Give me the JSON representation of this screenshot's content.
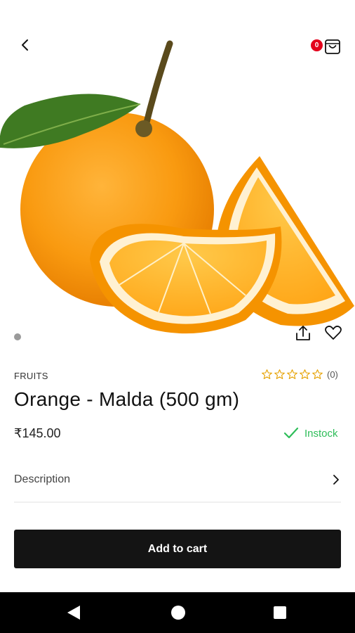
{
  "header": {
    "back_icon": "chevron-left-icon",
    "cart_icon": "shopping-bag-icon",
    "cart_count": "0",
    "badge_color": "#e3001b"
  },
  "hero": {
    "image_subject": "orange with leaf and slices",
    "carousel_index": 1,
    "share_icon": "share-icon",
    "favorite_icon": "heart-icon"
  },
  "product": {
    "category": "FRUITS",
    "name": "Orange - Malda (500 gm)",
    "price": "₹145.00",
    "rating_stars": 0,
    "rating_max": 5,
    "rating_count": "(0)",
    "stock_label": "Instock",
    "stock_color": "#2ebd59",
    "star_color": "#e6a100"
  },
  "details": {
    "description_label": "Description"
  },
  "actions": {
    "add_to_cart_label": "Add to cart",
    "button_color": "#141414"
  },
  "system_nav": {
    "back_icon": "nav-back-triangle-icon",
    "home_icon": "nav-home-circle-icon",
    "recents_icon": "nav-recents-square-icon"
  }
}
